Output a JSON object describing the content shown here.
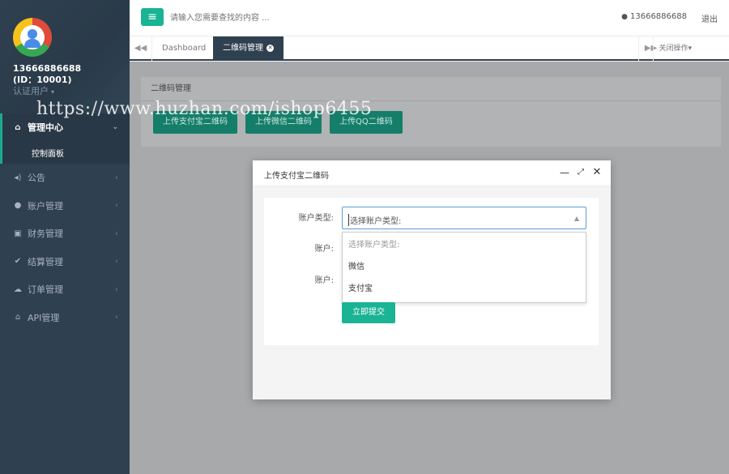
{
  "sidebar": {
    "profile": {
      "phone": "13666886688",
      "id_text": "(ID：10001)",
      "role": "认证用户"
    },
    "active_section": {
      "label": "管理中心",
      "icon": "home-icon",
      "sub_item": "控制面板"
    },
    "items": [
      {
        "label": "公告",
        "icon": "volume-icon"
      },
      {
        "label": "账户管理",
        "icon": "user-icon"
      },
      {
        "label": "财务管理",
        "icon": "money-icon"
      },
      {
        "label": "结算管理",
        "icon": "check-icon"
      },
      {
        "label": "订单管理",
        "icon": "cloud-upload-icon"
      },
      {
        "label": "API管理",
        "icon": "bank-icon"
      }
    ]
  },
  "topbar": {
    "search_placeholder": "请输入您需要查找的内容 ...",
    "user": "13666886688",
    "logout": "退出"
  },
  "tabs": {
    "items": [
      {
        "label": "Dashboard",
        "active": false
      },
      {
        "label": "二维码管理",
        "active": true
      }
    ],
    "close_ops": "关闭操作"
  },
  "panel": {
    "title": "二维码管理",
    "buttons": [
      "上传支付宝二维码",
      "上传微信二维码",
      "上传QQ二维码"
    ]
  },
  "watermark": "https://www.huzhan.com/ishop6455",
  "modal": {
    "title": "上传支付宝二维码",
    "fields": {
      "account_type_label": "账户类型:",
      "account_type_value": "选择账户类型:",
      "account_label_1": "账户:",
      "account_label_2": "账户:"
    },
    "dropdown_options": [
      "选择账户类型:",
      "微信",
      "支付宝"
    ],
    "submit": "立即提交"
  },
  "colors": {
    "sidebar_bg": "#2f4050",
    "accent": "#1ab394",
    "active_tab_bg": "#2f4050"
  }
}
